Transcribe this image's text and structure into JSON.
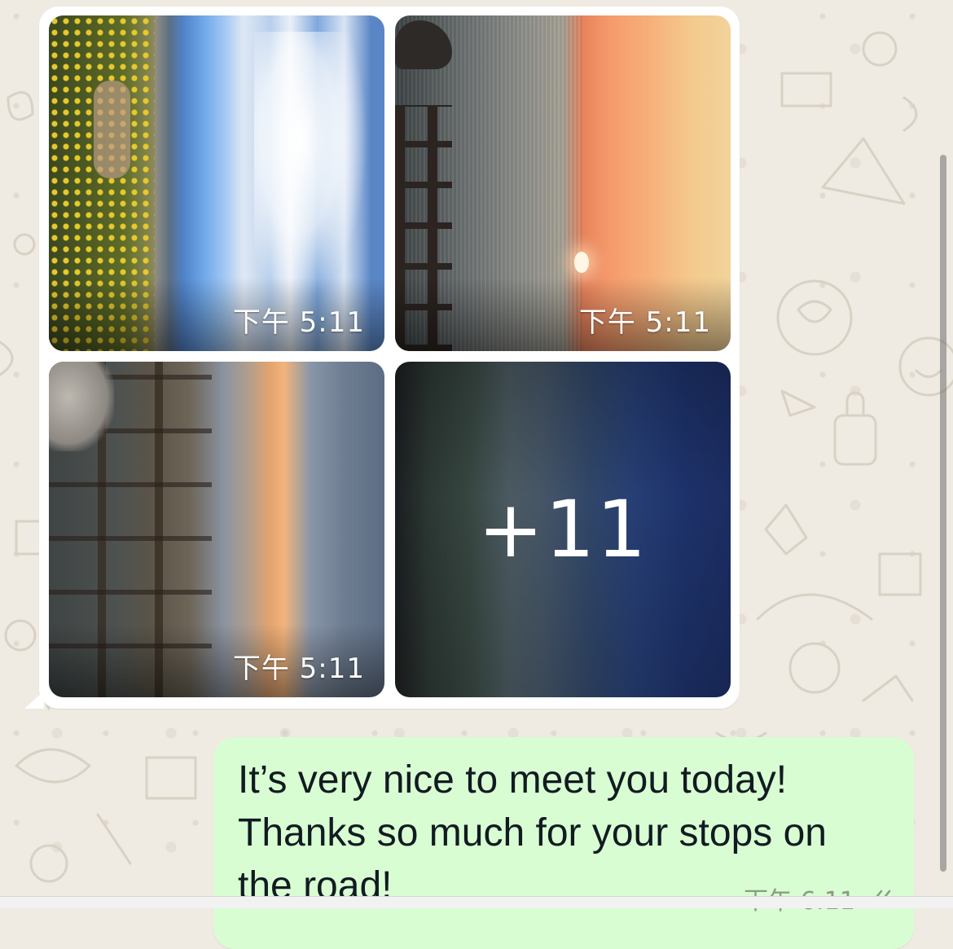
{
  "colors": {
    "chat_background": "#efeae2",
    "incoming_bubble": "#ffffff",
    "outgoing_bubble": "#d9fdd3",
    "timestamp_text": "#ffffff"
  },
  "media_group": {
    "photos": [
      {
        "timestamp": "下午 5:11"
      },
      {
        "timestamp": "下午 5:11"
      },
      {
        "timestamp": "下午 5:11"
      },
      {
        "more_label": "+11"
      }
    ]
  },
  "outgoing_message": {
    "text": "It’s very nice to meet you today!\nThanks so much for your stops on\nthe road!",
    "timestamp": "下午 6:11",
    "status_icon": "double-check-icon"
  }
}
